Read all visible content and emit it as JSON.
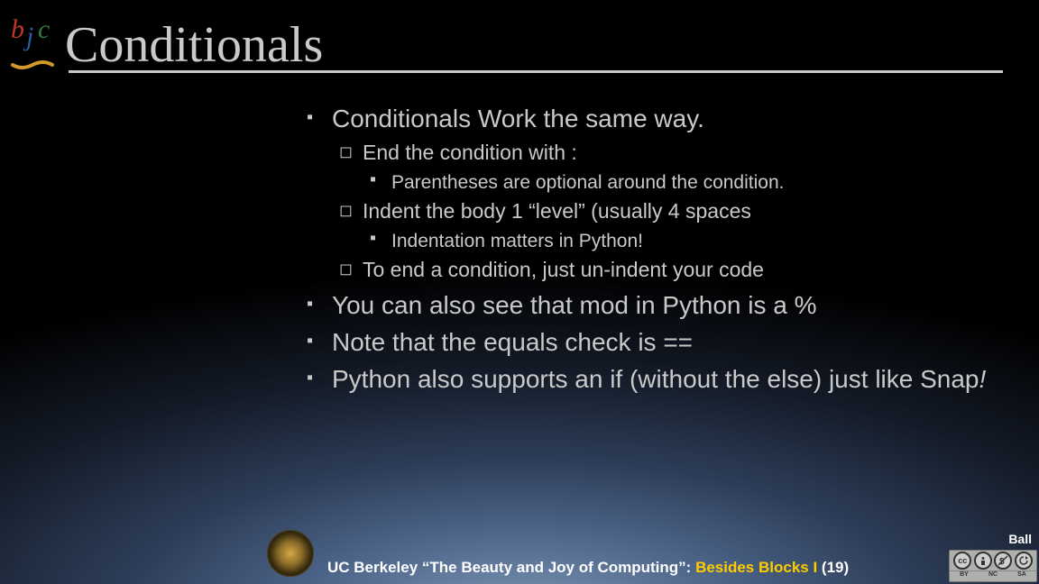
{
  "logo_letters": {
    "b": "b",
    "j": "j",
    "c": "c"
  },
  "title": "Conditionals",
  "bullets": {
    "l1a": "Conditionals Work the same way.",
    "l2a": "End the condition with :",
    "l3a": "Parentheses are optional around the condition.",
    "l2b": "Indent the body 1 “level” (usually 4 spaces",
    "l3b": "Indentation matters in Python!",
    "l2c": "To end a condition, just un-indent your code",
    "l1b": "You can also see that mod in Python is a %",
    "l1c": "Note that the equals check is ==",
    "l1d_a": "Python also supports an if (without the else) just like Snap",
    "l1d_b": "!"
  },
  "author": "Ball",
  "footer": {
    "a": "UC Berkeley “The Beauty and Joy of Computing”: ",
    "b": " Besides Blocks I ",
    "c": "(19)"
  },
  "cc": {
    "c1": "cc",
    "c2": "BY",
    "c3": "NC",
    "c4": "SA"
  }
}
